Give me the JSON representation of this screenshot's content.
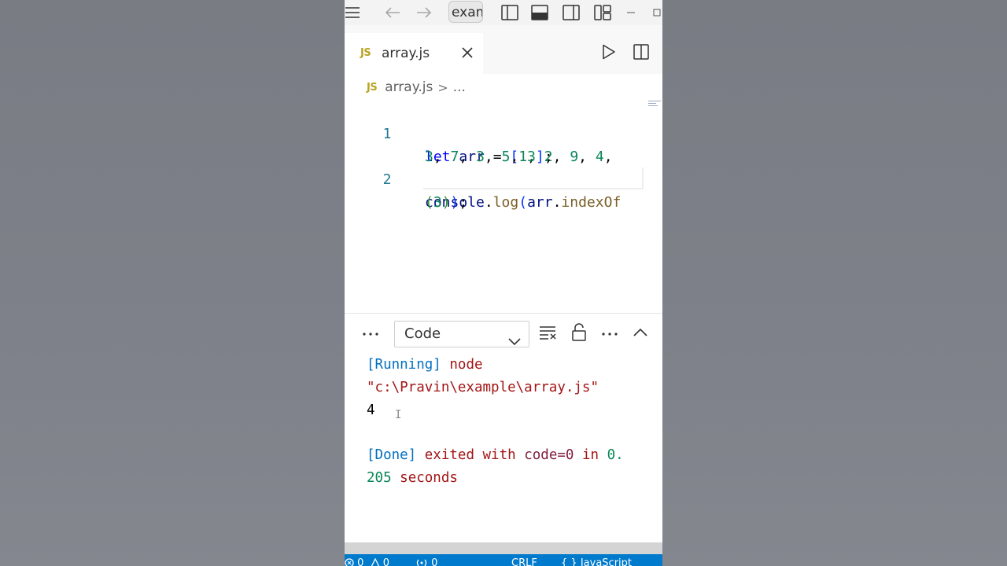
{
  "titlebar": {
    "search_text": "exam"
  },
  "tab": {
    "badge": "JS",
    "filename": "array.js"
  },
  "breadcrumb": {
    "badge": "JS",
    "file": "array.js",
    "separator": ">",
    "rest": "..."
  },
  "editor": {
    "lines": [
      {
        "number": "1",
        "wrap1": {
          "kw": "let",
          "var": "arr",
          "op": "=",
          "open": "[",
          "nums1": [
            "1",
            "2",
            "9",
            "4"
          ]
        },
        "wrap2": {
          "nums2": [
            "3",
            "7",
            "3",
            "5",
            "3"
          ],
          "close": "]",
          "end": ";"
        }
      },
      {
        "number": "2",
        "wrap1": {
          "obj": "console",
          "dot": ".",
          "fn": "log",
          "paren": "(",
          "arg": "arr",
          "dot2": ".",
          "method": "indexOf"
        },
        "wrap2": {
          "open": "(",
          "num": "3",
          "close": ")",
          "close2": ")",
          "end": ";"
        }
      }
    ]
  },
  "panel": {
    "select_value": "Code"
  },
  "output": {
    "line1_tag": "[Running]",
    "line1_cmd": "node",
    "line2_path": "\"c:\\Pravin\\example\\array.js\"",
    "line3_result": "4",
    "done_tag": "[Done]",
    "done_text1": "exited with",
    "done_code": "code=0",
    "done_text2": "in",
    "done_time_part1": "0.",
    "done_time_part2": "205",
    "done_text3": "seconds"
  },
  "statusbar": {
    "errors": "0",
    "warnings": "0",
    "ports": "0",
    "eol": "CRLF",
    "language": "JavaScript"
  },
  "colors": {
    "accent": "#007acc",
    "keyword": "#0000ff",
    "number": "#098658",
    "js_badge": "#b8a322"
  }
}
